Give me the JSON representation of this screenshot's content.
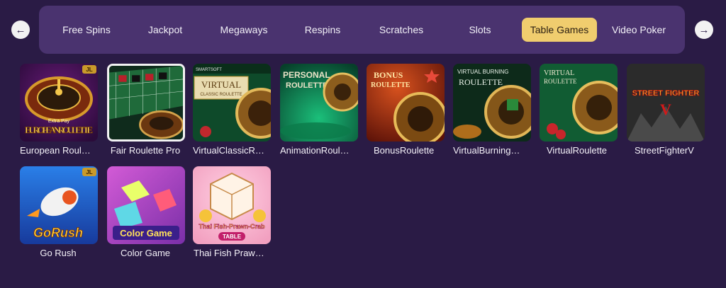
{
  "nav": {
    "prev_icon": "arrow-left-icon",
    "next_icon": "arrow-right-icon",
    "prev_glyph": "←",
    "next_glyph": "→"
  },
  "tabs": [
    {
      "label": "Free Spins",
      "active": false
    },
    {
      "label": "Jackpot",
      "active": false
    },
    {
      "label": "Megaways",
      "active": false
    },
    {
      "label": "Respins",
      "active": false
    },
    {
      "label": "Scratches",
      "active": false
    },
    {
      "label": "Slots",
      "active": false
    },
    {
      "label": "Table Games",
      "active": true
    },
    {
      "label": "Video Poker",
      "active": false
    }
  ],
  "games": [
    {
      "name": "European Roul…",
      "art_text": "EUROPEAN ROULETTE",
      "art_small": "Extra Pay",
      "badge": "JL"
    },
    {
      "name": "Fair Roulette Pro",
      "art_text": "",
      "art_small": "",
      "badge": ""
    },
    {
      "name": "VirtualClassicR…",
      "art_text": "VIRTUAL",
      "art_small": "CLASSIC ROULETTE",
      "badge": "SMARTSOFT"
    },
    {
      "name": "AnimationRoul…",
      "art_text": "PERSONAL",
      "art_small": "ROULETTE",
      "badge": ""
    },
    {
      "name": "BonusRoulette",
      "art_text": "BONUS",
      "art_small": "ROULETTE",
      "badge": ""
    },
    {
      "name": "VirtualBurning…",
      "art_text": "VIRTUAL BURNING",
      "art_small": "ROULETTE",
      "badge": ""
    },
    {
      "name": "VirtualRoulette",
      "art_text": "VIRTUAL",
      "art_small": "ROULETTE",
      "badge": ""
    },
    {
      "name": "StreetFighterV",
      "art_text": "STREET FIGHTER",
      "art_small": "V",
      "badge": ""
    },
    {
      "name": "Go Rush",
      "art_text": "GoRush",
      "art_small": "",
      "badge": "JL"
    },
    {
      "name": "Color Game",
      "art_text": "Color Game",
      "art_small": "",
      "badge": ""
    },
    {
      "name": "Thai Fish Praw…",
      "art_text": "Thai Fish-Prawn-Crab",
      "art_small": "TABLE",
      "badge": ""
    }
  ],
  "colors": {
    "background": "#2a1b45",
    "tab_bar": "#4a336f",
    "active_tab": "#f0cd6e"
  }
}
